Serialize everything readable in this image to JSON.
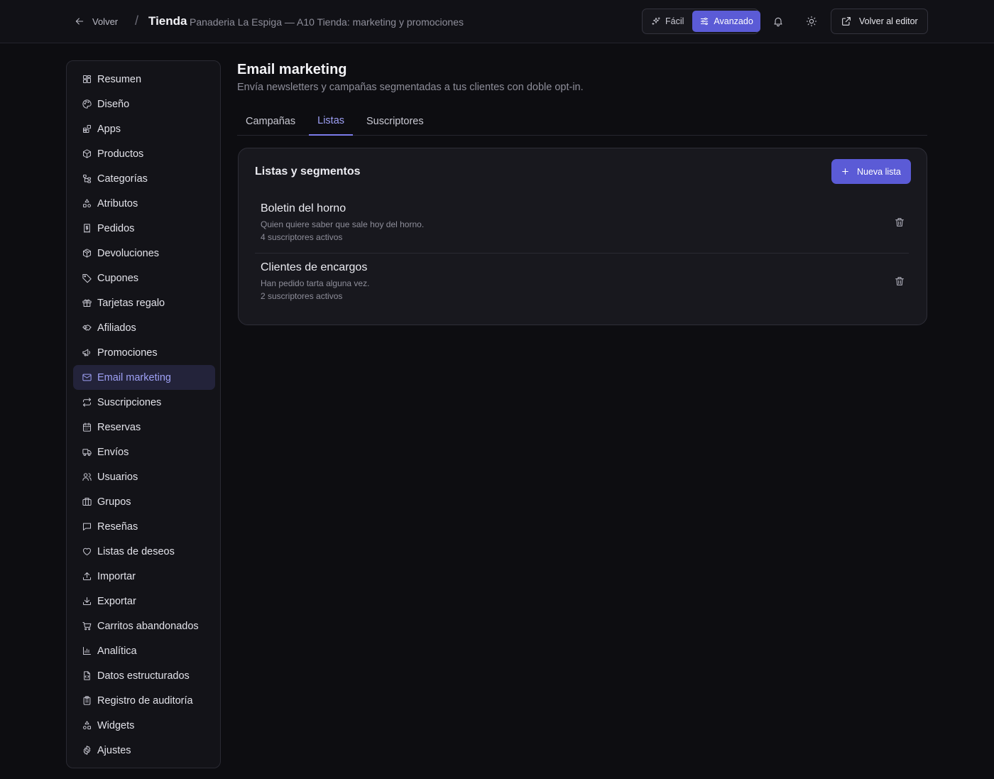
{
  "header": {
    "back_label": "Volver",
    "separator": "/",
    "store_title": "Tienda",
    "store_subtitle": "Panaderia La Espiga — A10 Tienda: marketing y promociones",
    "mode_easy": "Fácil",
    "mode_advanced": "Avanzado",
    "active_mode": "Avanzado",
    "editor_button": "Volver al editor"
  },
  "sidebar": {
    "active": "Email marketing",
    "items": [
      {
        "label": "Resumen",
        "icon": "dashboard-icon"
      },
      {
        "label": "Diseño",
        "icon": "palette-icon"
      },
      {
        "label": "Apps",
        "icon": "apps-icon"
      },
      {
        "label": "Productos",
        "icon": "box-icon"
      },
      {
        "label": "Categorías",
        "icon": "tree-icon"
      },
      {
        "label": "Atributos",
        "icon": "shapes-icon"
      },
      {
        "label": "Pedidos",
        "icon": "receipt-icon"
      },
      {
        "label": "Devoluciones",
        "icon": "package-return-icon"
      },
      {
        "label": "Cupones",
        "icon": "tag-icon"
      },
      {
        "label": "Tarjetas regalo",
        "icon": "gift-icon"
      },
      {
        "label": "Afiliados",
        "icon": "handshake-icon"
      },
      {
        "label": "Promociones",
        "icon": "megaphone-icon"
      },
      {
        "label": "Email marketing",
        "icon": "mail-icon"
      },
      {
        "label": "Suscripciones",
        "icon": "repeat-icon"
      },
      {
        "label": "Reservas",
        "icon": "calendar-icon"
      },
      {
        "label": "Envíos",
        "icon": "truck-icon"
      },
      {
        "label": "Usuarios",
        "icon": "users-icon"
      },
      {
        "label": "Grupos",
        "icon": "groups-icon"
      },
      {
        "label": "Reseñas",
        "icon": "message-icon"
      },
      {
        "label": "Listas de deseos",
        "icon": "heart-icon"
      },
      {
        "label": "Importar",
        "icon": "upload-icon"
      },
      {
        "label": "Exportar",
        "icon": "download-icon"
      },
      {
        "label": "Carritos abandonados",
        "icon": "cart-icon"
      },
      {
        "label": "Analítica",
        "icon": "bar-chart-icon"
      },
      {
        "label": "Datos estructurados",
        "icon": "file-code-icon"
      },
      {
        "label": "Registro de auditoría",
        "icon": "clipboard-icon"
      },
      {
        "label": "Widgets",
        "icon": "widgets-icon"
      },
      {
        "label": "Ajustes",
        "icon": "gear-icon"
      }
    ]
  },
  "main": {
    "title": "Email marketing",
    "description": "Envía newsletters y campañas segmentadas a tus clientes con doble opt-in.",
    "tabs": [
      {
        "label": "Campañas"
      },
      {
        "label": "Listas"
      },
      {
        "label": "Suscriptores"
      }
    ],
    "active_tab": "Listas",
    "card": {
      "title": "Listas y segmentos",
      "new_button": "Nueva lista",
      "lists": [
        {
          "name": "Boletin del horno",
          "description": "Quien quiere saber que sale hoy del horno.",
          "subscribers": "4 suscriptores activos"
        },
        {
          "name": "Clientes de encargos",
          "description": "Han pedido tarta alguna vez.",
          "subscribers": "2 suscriptores activos"
        }
      ]
    }
  },
  "colors": {
    "background": "#0d0d11",
    "accent": "#5b5bd6",
    "accent_text": "#9ea0f5",
    "muted_text": "#8e8e9a"
  }
}
